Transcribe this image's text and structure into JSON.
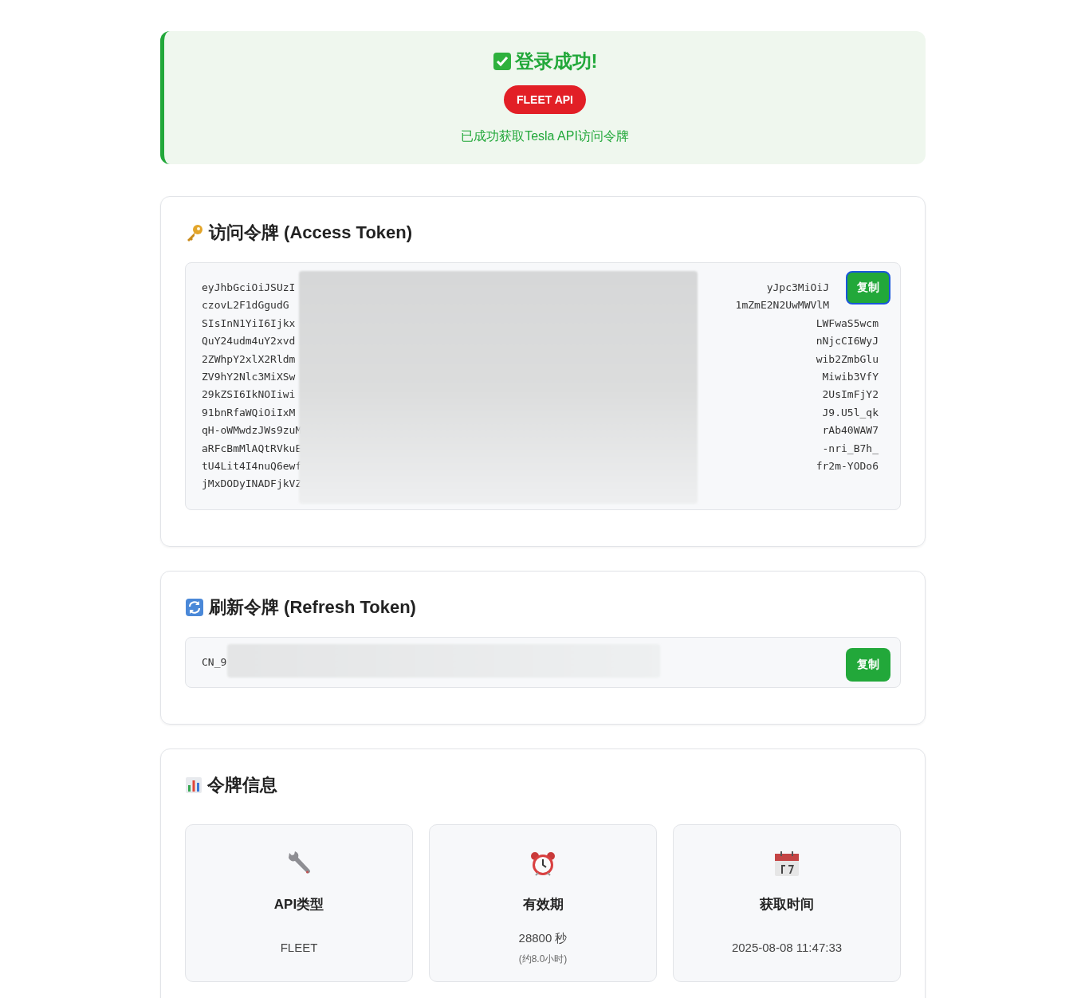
{
  "banner": {
    "title": "登录成功!",
    "badge": "FLEET API",
    "message": "已成功获取Tesla API访问令牌"
  },
  "access_token": {
    "title": "访问令牌 (Access Token)",
    "copy_button": "复制",
    "redacted": true,
    "lines": [
      {
        "start": "eyJhbGciOiJSUzI",
        "end": "yJpc3MiOiJ"
      },
      {
        "start": "czovL2F1dGgudG",
        "end": "1mZmE2N2UwMWVlM"
      },
      {
        "start": "SIsInN1YiI6Ijkx",
        "end": "LWFwaS5wcm"
      },
      {
        "start": "QuY24udm4uY2xvd",
        "end": "nNjcCI6WyJ"
      },
      {
        "start": "2ZWhpY2xlX2Rldm",
        "end": "wib2ZmbGlu"
      },
      {
        "start": "ZV9hY2Nlc3MiXSw",
        "end": "Miwib3VfY"
      },
      {
        "start": "29kZSI6IkNOIiwi",
        "end": "2UsImFjY2"
      },
      {
        "start": "91bnRfaWQiOiIxM",
        "end": "J9.U5l_qk"
      },
      {
        "start": "qH-oWMwdzJWs9zuM",
        "end": "rAb40WAW7"
      },
      {
        "start": "aRFcBmMlAQtRVkuE",
        "end": "-nri_B7h_"
      },
      {
        "start": "tU4Lit4I4nuQ6ewf",
        "end": "fr2m-YODo6"
      },
      {
        "start": "jMxDODyINADFjkVZ"
      }
    ]
  },
  "refresh_token": {
    "title": "刷新令牌 (Refresh Token)",
    "copy_button": "复制",
    "redacted": true,
    "value": "CN_9"
  },
  "token_info": {
    "title": "令牌信息",
    "cards": [
      {
        "kind": "wrench",
        "label": "API类型",
        "value": "FLEET"
      },
      {
        "kind": "clock",
        "label": "有效期",
        "value": "28800 秒",
        "note": "(约8.0小时)"
      },
      {
        "kind": "calendar",
        "label": "获取时间",
        "value": "2025-08-08 11:47:33"
      }
    ]
  }
}
